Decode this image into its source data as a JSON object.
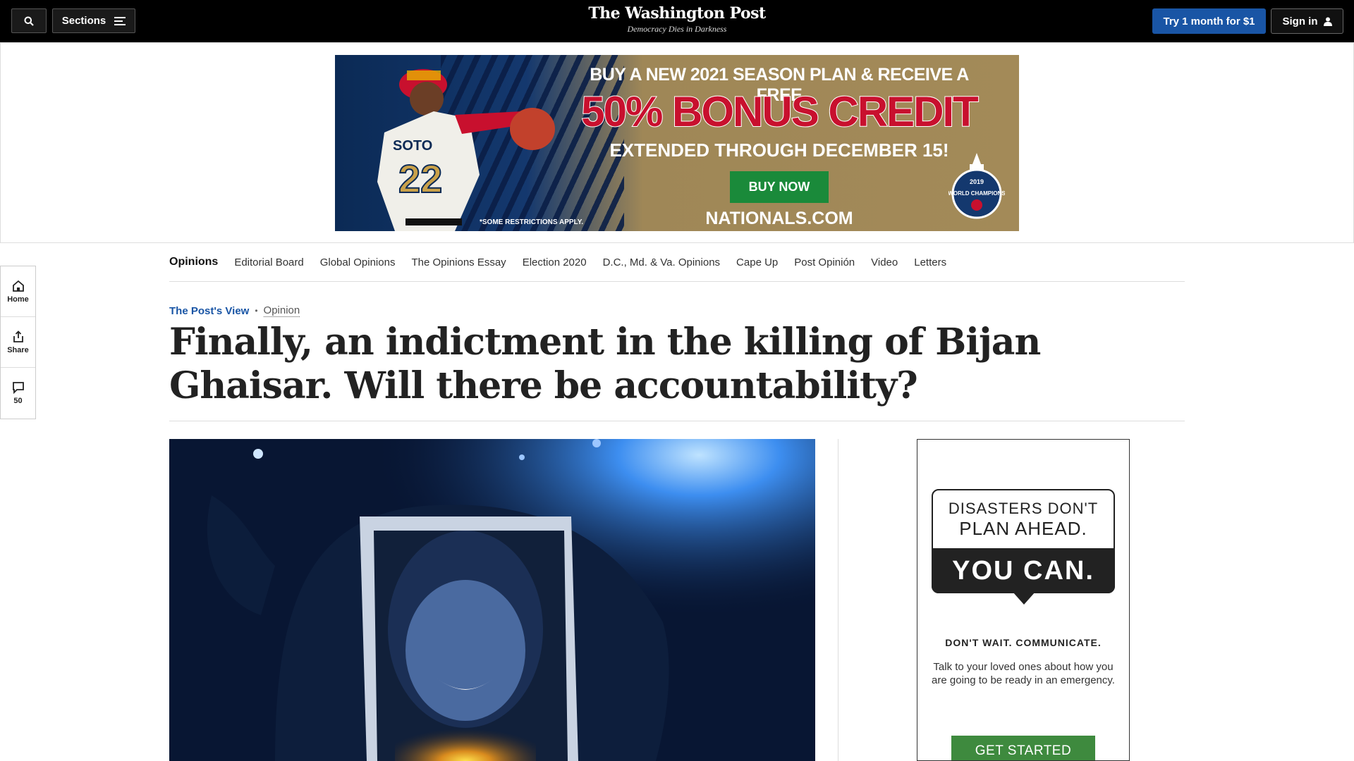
{
  "header": {
    "sections_label": "Sections",
    "logo_name": "The Washington Post",
    "logo_tagline": "Democracy Dies in Darkness",
    "try_label": "Try 1 month for $1",
    "signin_label": "Sign in",
    "icons": [
      "search-icon",
      "menu-icon",
      "user-icon"
    ]
  },
  "banner_ad": {
    "line1": "BUY A NEW 2021 SEASON PLAN & RECEIVE A FREE",
    "line2": "50% BONUS CREDIT",
    "line3": "EXTENDED THROUGH DECEMBER 15!",
    "button": "BUY NOW",
    "site": "NATIONALS.COM",
    "restrictions": "*SOME RESTRICTIONS APPLY.",
    "badge_year": "2019",
    "badge_text": "WORLD CHAMPIONS",
    "colors": {
      "red": "#c8102e",
      "gold": "#a38a58",
      "navy": "#14386e",
      "green": "#1a8a3a"
    }
  },
  "section_nav": {
    "items": [
      "Opinions",
      "Editorial Board",
      "Global Opinions",
      "The Opinions Essay",
      "Election 2020",
      "D.C., Md. & Va. Opinions",
      "Cape Up",
      "Post Opinión",
      "Video",
      "Letters"
    ]
  },
  "left_rail": {
    "home": "Home",
    "share": "Share",
    "comments": "50"
  },
  "article": {
    "kicker_blog": "The Post's View",
    "kicker_section": "Opinion",
    "headline": "Finally, an indictment in the killing of Bijan Ghaisar. Will there be accountability?"
  },
  "side_ad": {
    "line1": "DISASTERS DON'T",
    "line2": "PLAN AHEAD.",
    "line3": "YOU CAN.",
    "dont_wait": "DON'T WAIT. COMMUNICATE.",
    "body": "Talk to your loved ones about how you are going to be ready in an emergency.",
    "button": "GET STARTED"
  }
}
